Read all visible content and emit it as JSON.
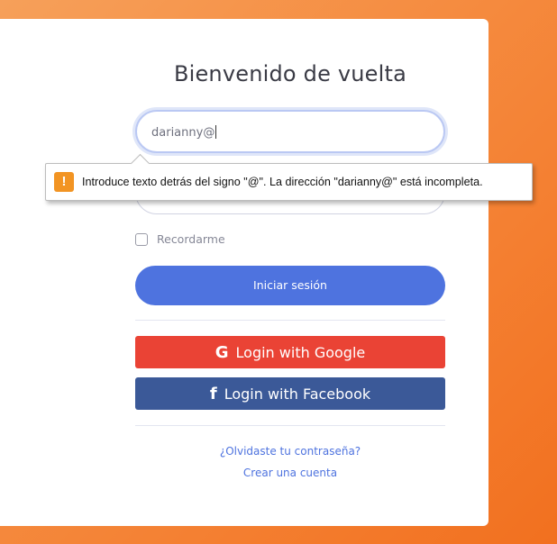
{
  "page": {
    "title": "Bienvenido de vuelta"
  },
  "form": {
    "email_value": "darianny@",
    "password_value": "",
    "remember_label": "Recordarme",
    "remember_checked": false,
    "login_button": "Iniciar sesión"
  },
  "social": {
    "google_label": "Login with Google",
    "google_icon": "G",
    "facebook_label": "Login with Facebook",
    "facebook_icon": "f",
    "google_color": "#ea4335",
    "facebook_color": "#3b5998"
  },
  "links": {
    "forgot": "¿Olvidaste tu contraseña?",
    "create": "Crear una cuenta"
  },
  "validation": {
    "icon": "!",
    "message": "Introduce texto detrás del signo \"@\". La dirección \"darianny@\" está incompleta."
  },
  "colors": {
    "primary": "#4e73df",
    "warning": "#f29423",
    "background_orange": "#f58a3e"
  }
}
